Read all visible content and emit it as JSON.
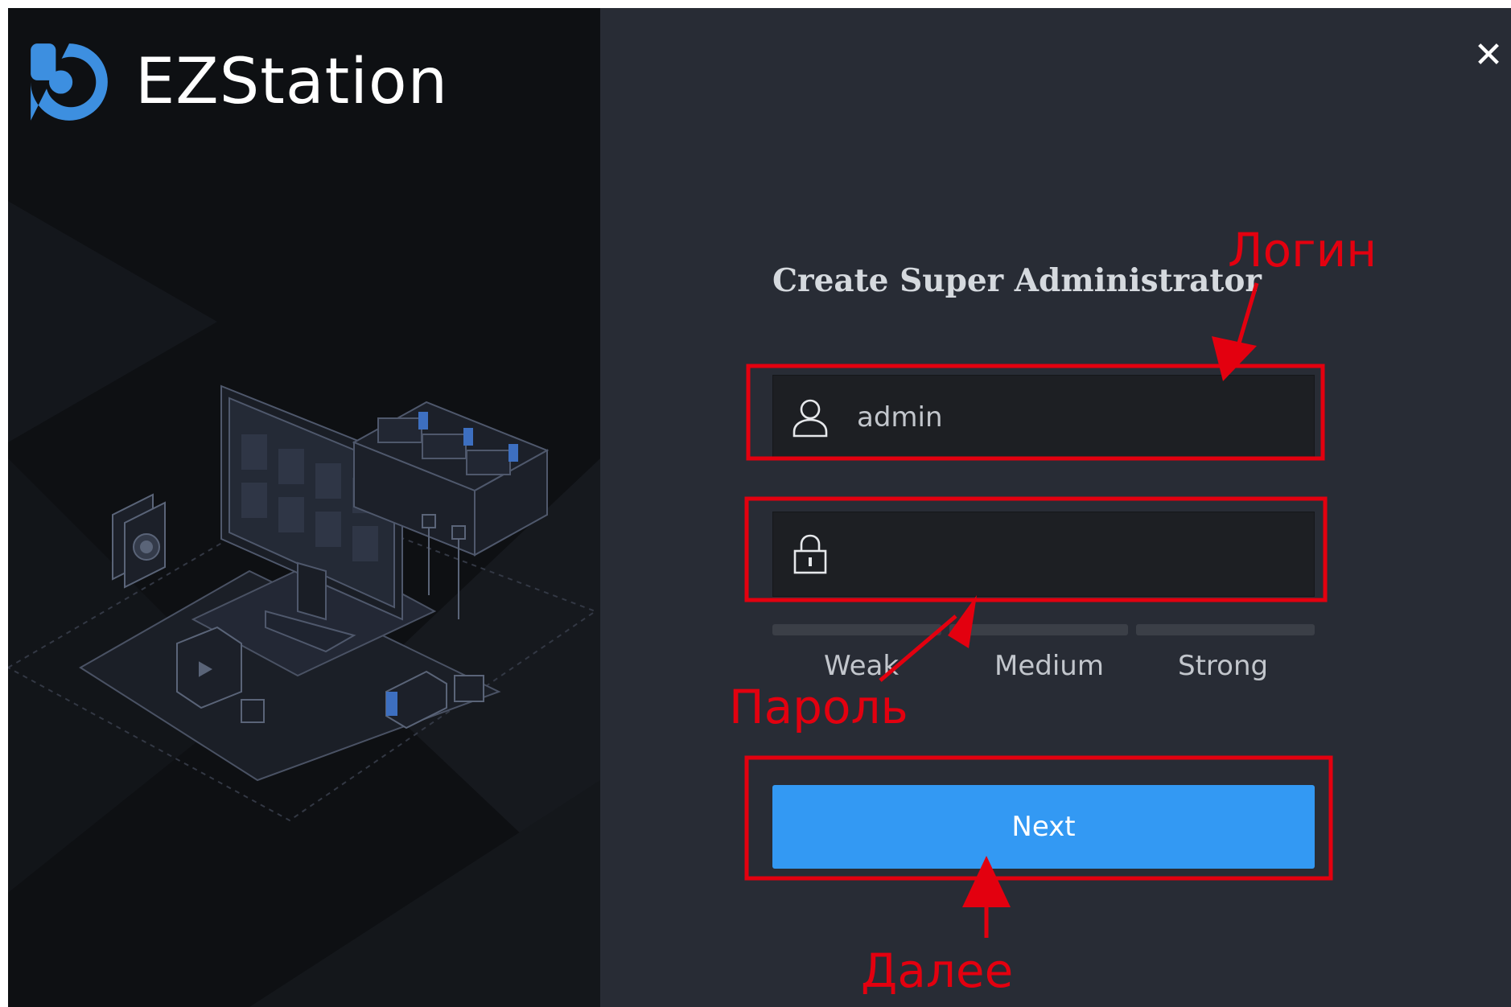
{
  "app": {
    "name": "EZStation",
    "close_icon": "close-icon",
    "logo_icon": "ezstation-logo-icon"
  },
  "form": {
    "title": "Create Super Administrator",
    "username": {
      "value": "admin",
      "icon": "user-icon"
    },
    "password": {
      "value": "",
      "icon": "lock-icon"
    },
    "strength": {
      "labels": [
        "Weak",
        "Medium",
        "Strong"
      ],
      "level": 0
    },
    "next_label": "Next"
  },
  "annotations": {
    "login_label": "Логин",
    "password_label": "Пароль",
    "next_label": "Далее",
    "color": "#e3000f"
  },
  "colors": {
    "accent": "#3399f3",
    "left_panel": "#0e1013",
    "right_panel": "#282c35",
    "field_bg": "#1d1f23",
    "logo_blue": "#3d8fe0"
  }
}
